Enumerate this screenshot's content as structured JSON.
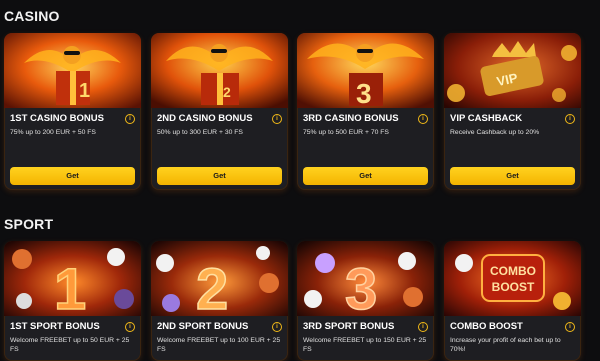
{
  "sections": [
    {
      "title": "CASINO",
      "cards": [
        {
          "title": "1ST CASINO BONUS",
          "desc": "75% up to 200 EUR + 50 FS",
          "button": "Get",
          "badge": "1"
        },
        {
          "title": "2ND CASINO BONUS",
          "desc": "50% up to 300 EUR + 30 FS",
          "button": "Get",
          "badge": "2"
        },
        {
          "title": "3RD CASINO BONUS",
          "desc": "75% up to 500 EUR + 70 FS",
          "button": "Get",
          "badge": "3"
        },
        {
          "title": "VIP CASHBACK",
          "desc": "Receive Cashback up to 20%",
          "button": "Get",
          "badge": "VIP"
        }
      ]
    },
    {
      "title": "SPORT",
      "cards": [
        {
          "title": "1ST SPORT BONUS",
          "desc": "Welcome FREEBET up to 50 EUR + 25 FS",
          "badge": "1"
        },
        {
          "title": "2ND SPORT BONUS",
          "desc": "Welcome FREEBET up to 100 EUR + 25 FS",
          "badge": "2"
        },
        {
          "title": "3RD SPORT BONUS",
          "desc": "Welcome FREEBET up to 150 EUR + 25 FS",
          "badge": "3"
        },
        {
          "title": "COMBO BOOST",
          "desc": "Increase your profit of each bet up to 70%!",
          "badge_line1": "COMBO",
          "badge_line2": "BOOST"
        }
      ]
    }
  ],
  "info_glyph": "i",
  "colors": {
    "accent": "#f4b400",
    "card": "#1e1e22",
    "bg": "#0d0d0f"
  }
}
